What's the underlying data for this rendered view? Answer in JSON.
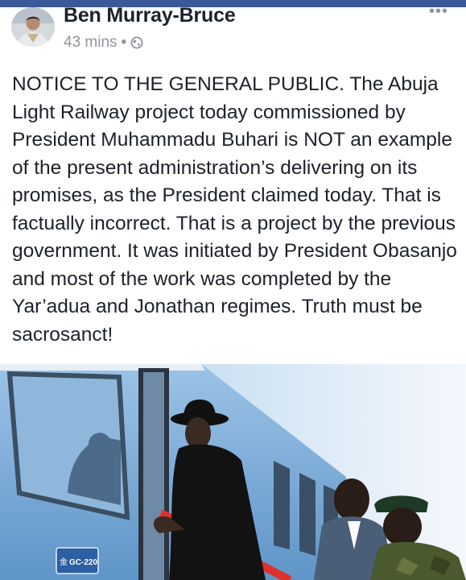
{
  "post": {
    "author": "Ben Murray-Bruce",
    "time": "43 mins",
    "separator": "•",
    "privacy_icon": "globe-icon",
    "more_icon": "more-options-icon",
    "more_label": "•••",
    "text": "NOTICE TO THE GENERAL PUBLIC. The Abuja Light Railway project today commissioned by President Muhammadu Buhari is NOT an example of the present administration’s delivering on its promises, as the President claimed today. That is factually incorrect. That is a project by the previous government. It was initiated by President Obasanjo and most of the work was completed by the Yar’adua and Jonathan regimes. Truth must be sacrosanct!",
    "photo": {
      "train_label": "GC-220",
      "train_label_prefix": "金"
    }
  },
  "colors": {
    "brand_bar": "#3b5998",
    "text": "#1d2129",
    "meta": "#90949c"
  }
}
